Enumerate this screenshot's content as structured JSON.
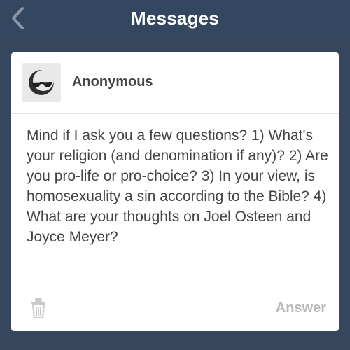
{
  "navbar": {
    "title": "Messages",
    "back_icon": "chevron-left-icon"
  },
  "message": {
    "sender": "Anonymous",
    "avatar_icon": "anonymous-sunglasses-icon",
    "text": "Mind if I ask you a few questions? 1) What's your religion (and denomination if any)? 2) Are you pro-life or pro-choice? 3) In your view, is homosexuality a sin according to the Bible? 4) What are your thoughts on Joel Osteen and Joyce Meyer?",
    "actions": {
      "delete_icon": "trash-icon",
      "answer_label": "Answer"
    }
  },
  "colors": {
    "background": "#36465d",
    "card": "#ffffff",
    "text": "#444444",
    "answer": "#b9b9b9"
  }
}
